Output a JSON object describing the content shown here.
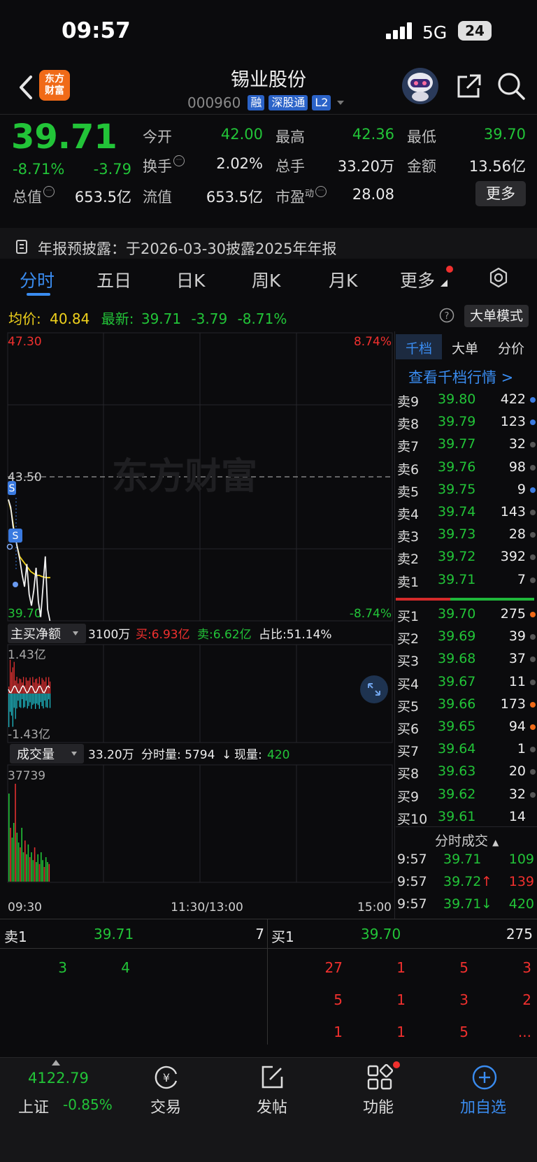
{
  "status": {
    "time": "09:57",
    "network": "5G",
    "battery": "24"
  },
  "header": {
    "logo_line1": "东方",
    "logo_line2": "财富",
    "name": "锡业股份",
    "code": "000960",
    "tags": [
      "融",
      "深股通",
      "L2"
    ]
  },
  "quote": {
    "price": "39.71",
    "change_pct": "-8.71%",
    "change": "-3.79",
    "fields": [
      {
        "label": "今开",
        "value": "42.00",
        "color": "green"
      },
      {
        "label": "最高",
        "value": "42.36",
        "color": "green"
      },
      {
        "label": "最低",
        "value": "39.70",
        "color": "green"
      },
      {
        "label": "换手",
        "value": "2.02%",
        "color": "white"
      },
      {
        "label": "总手",
        "value": "33.20万",
        "color": "white"
      },
      {
        "label": "金额",
        "value": "13.56亿",
        "color": "white"
      },
      {
        "label": "总值",
        "value": "653.5亿",
        "color": "white"
      },
      {
        "label": "流值",
        "value": "653.5亿",
        "color": "white"
      },
      {
        "label": "市盈",
        "value": "28.08",
        "color": "white"
      }
    ],
    "pe_sup": "动",
    "more": "更多"
  },
  "notice": "年报预披露：于2026-03-30披露2025年年报",
  "tabs": [
    "分时",
    "五日",
    "日K",
    "周K",
    "月K",
    "更多"
  ],
  "avg_row": {
    "avg_label": "均价:",
    "avg_value": "40.84",
    "latest_label": "最新:",
    "latest_value": "39.71",
    "latest_change": "-3.79",
    "latest_pct": "-8.71%",
    "big_order_mode": "大单模式"
  },
  "chart": {
    "y_top": "47.30",
    "y_mid": "43.50",
    "y_bottom": "39.70",
    "pct_top": "8.74%",
    "pct_bottom": "-8.74%",
    "watermark": "东方财富",
    "price_line": [
      42.9,
      42.7,
      42.2,
      41.9,
      41.6,
      41.3,
      40.9,
      40.6,
      41.2,
      40.4,
      40.1,
      40.5,
      41.1,
      40.2,
      39.8,
      40.6,
      41.4,
      40.0,
      39.7
    ],
    "avg_line": [
      42.9,
      42.6,
      42.1,
      41.7,
      41.4,
      41.3,
      41.2,
      41.1,
      41.0,
      40.95,
      40.9,
      40.9,
      40.87,
      40.85,
      40.84,
      40.84
    ],
    "signal_marker": "S",
    "net_buy": {
      "label": "主买净额",
      "amount": "3100万",
      "buy_label": "买:6.93亿",
      "sell_label": "卖:6.62亿",
      "ratio_label": "占比:51.14%",
      "y_top": "1.43亿",
      "y_bottom": "-1.43亿"
    },
    "volume": {
      "label": "成交量",
      "total": "33.20万",
      "minute_label": "分时量: 5794",
      "now_label": "现量:",
      "now_value": "420",
      "y_top": "37739",
      "bars": [
        0.9,
        0.55,
        0.45,
        0.6,
        1.0,
        0.5,
        0.4,
        0.35,
        0.55,
        0.3,
        0.42,
        0.28,
        0.38,
        0.25,
        0.3,
        0.22,
        0.35,
        0.2,
        0.28,
        0.18,
        0.3,
        0.22,
        0.15,
        0.25,
        0.2,
        0.18
      ]
    },
    "x_start": "09:30",
    "x_mid": "11:30/13:00",
    "x_end": "15:00"
  },
  "orderbook": {
    "tabs": [
      "千档",
      "大单",
      "分价"
    ],
    "view_more": "查看千档行情 >",
    "asks": [
      {
        "label": "卖9",
        "price": "39.80",
        "vol": "422",
        "dot": "#3a7ae0"
      },
      {
        "label": "卖8",
        "price": "39.79",
        "vol": "123",
        "dot": "#3a7ae0"
      },
      {
        "label": "卖7",
        "price": "39.77",
        "vol": "32",
        "dot": "#555555"
      },
      {
        "label": "卖6",
        "price": "39.76",
        "vol": "98",
        "dot": "#555555"
      },
      {
        "label": "卖5",
        "price": "39.75",
        "vol": "9",
        "dot": "#3a7ae0"
      },
      {
        "label": "卖4",
        "price": "39.74",
        "vol": "143",
        "dot": "#555555"
      },
      {
        "label": "卖3",
        "price": "39.73",
        "vol": "28",
        "dot": "#555555"
      },
      {
        "label": "卖2",
        "price": "39.72",
        "vol": "392",
        "dot": "#555555"
      },
      {
        "label": "卖1",
        "price": "39.71",
        "vol": "7",
        "dot": "#555555"
      }
    ],
    "bids": [
      {
        "label": "买1",
        "price": "39.70",
        "vol": "275",
        "dot": "#f06a18"
      },
      {
        "label": "买2",
        "price": "39.69",
        "vol": "39",
        "dot": "#555555"
      },
      {
        "label": "买3",
        "price": "39.68",
        "vol": "37",
        "dot": "#555555"
      },
      {
        "label": "买4",
        "price": "39.67",
        "vol": "11",
        "dot": "#555555"
      },
      {
        "label": "买5",
        "price": "39.66",
        "vol": "173",
        "dot": "#f06a18"
      },
      {
        "label": "买6",
        "price": "39.65",
        "vol": "94",
        "dot": "#f06a18"
      },
      {
        "label": "买7",
        "price": "39.64",
        "vol": "1",
        "dot": "#555555"
      },
      {
        "label": "买8",
        "price": "39.63",
        "vol": "20",
        "dot": "#555555"
      },
      {
        "label": "买9",
        "price": "39.62",
        "vol": "32",
        "dot": "#555555"
      },
      {
        "label": "买10",
        "price": "39.61",
        "vol": "14",
        "dot": ""
      }
    ],
    "ticks_title": "分时成交",
    "ticks": [
      {
        "time": "9:57",
        "price": "39.71",
        "arrow": "",
        "vol": "109",
        "vol_color": "green"
      },
      {
        "time": "9:57",
        "price": "39.72",
        "arrow": "↑",
        "vol": "139",
        "vol_color": "red"
      },
      {
        "time": "9:57",
        "price": "39.71",
        "arrow": "↓",
        "vol": "420",
        "vol_color": "green"
      }
    ]
  },
  "level_bar": {
    "sell_label": "卖1",
    "sell_price": "39.71",
    "sell_vol": "7",
    "buy_label": "买1",
    "buy_price": "39.70",
    "buy_vol": "275",
    "sell_queue": [
      "3",
      "4"
    ],
    "buy_queue": [
      "27",
      "1",
      "5",
      "3",
      "5",
      "1",
      "3",
      "2",
      "1",
      "1",
      "5",
      "..."
    ]
  },
  "bottom_nav": {
    "index_value": "4122.79",
    "index_name": "上证",
    "index_change": "-0.85%",
    "items": [
      "交易",
      "发帖",
      "功能",
      "加自选"
    ]
  }
}
